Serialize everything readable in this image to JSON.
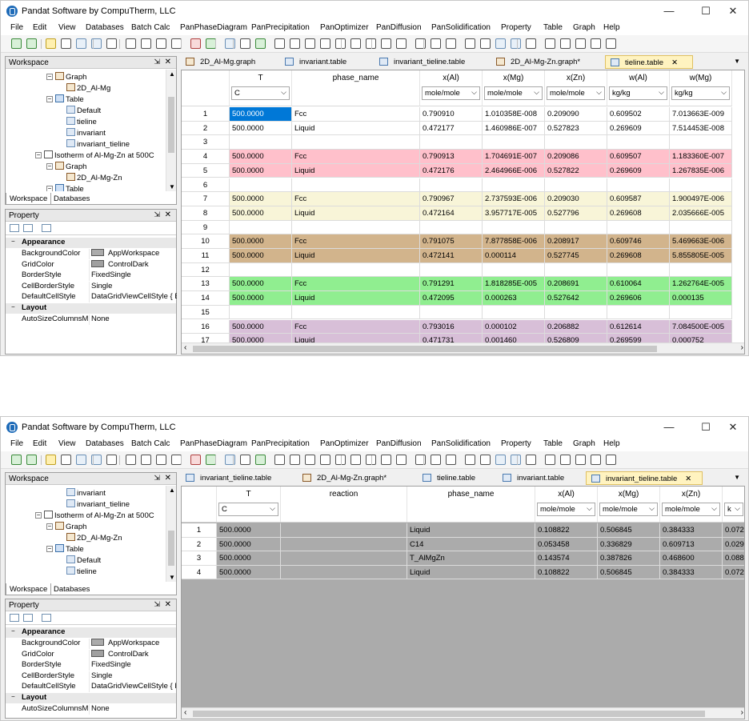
{
  "app_title": "Pandat Software by CompuTherm, LLC",
  "window_controls": [
    "—",
    "☐",
    "✕"
  ],
  "menu": [
    "File",
    "Edit",
    "View",
    "Databases",
    "Batch Calc",
    "PanPhaseDiagram",
    "PanPrecipitation",
    "PanOptimizer",
    "PanDiffusion",
    "PanSolidification",
    "Property",
    "Table",
    "Graph",
    "Help"
  ],
  "menu_underline": [
    "F",
    "E",
    "V",
    "D",
    "B",
    "P",
    "P",
    "P",
    "P",
    "P",
    "P",
    "T",
    "G",
    "H"
  ],
  "workspace": {
    "title": "Workspace",
    "pin": "⇲",
    "close": "✕",
    "tabs": [
      "Workspace",
      "Databases"
    ]
  },
  "property": {
    "title": "Property",
    "categories": [
      "Appearance",
      "Layout"
    ],
    "rows": [
      {
        "name": "BackgroundColor",
        "value": "AppWorkspace",
        "swatch": "#ababab"
      },
      {
        "name": "GridColor",
        "value": "ControlDark",
        "swatch": "#a0a0a0"
      },
      {
        "name": "BorderStyle",
        "value": "FixedSingle"
      },
      {
        "name": "CellBorderStyle",
        "value": "Single"
      },
      {
        "name": "DefaultCellStyle",
        "value": "DataGridViewCellStyle { B"
      }
    ],
    "layout_rows": [
      {
        "name": "AutoSizeColumnsM",
        "value": "None"
      }
    ]
  },
  "window1": {
    "tree": [
      {
        "label": "Graph",
        "icon": "graph",
        "indent": 1,
        "exp": "⊟"
      },
      {
        "label": "2D_Al-Mg",
        "icon": "graph",
        "indent": 2
      },
      {
        "label": "Table",
        "icon": "fold",
        "indent": 1,
        "exp": "⊟"
      },
      {
        "label": "Default",
        "icon": "table",
        "indent": 2
      },
      {
        "label": "tieline",
        "icon": "table",
        "indent": 2
      },
      {
        "label": "invariant",
        "icon": "table",
        "indent": 2
      },
      {
        "label": "invariant_tieline",
        "icon": "table",
        "indent": 2
      },
      {
        "label": "Isotherm of Al-Mg-Zn at 500C",
        "icon": "iso",
        "indent": 0,
        "exp": "⊟"
      },
      {
        "label": "Graph",
        "icon": "graph",
        "indent": 1,
        "exp": "⊟"
      },
      {
        "label": "2D_Al-Mg-Zn",
        "icon": "graph",
        "indent": 2
      },
      {
        "label": "Table",
        "icon": "fold",
        "indent": 1,
        "exp": "⊟"
      }
    ],
    "doc_tabs": [
      {
        "label": "2D_Al-Mg.graph",
        "type": "graph"
      },
      {
        "label": "invariant.table",
        "type": "table"
      },
      {
        "label": "invariant_tieline.table",
        "type": "table"
      },
      {
        "label": "2D_Al-Mg-Zn.graph*",
        "type": "graph"
      },
      {
        "label": "tieline.table",
        "type": "table",
        "active": true
      }
    ],
    "columns": [
      {
        "name": "T",
        "unit": "C"
      },
      {
        "name": "phase_name",
        "unit": ""
      },
      {
        "name": "x(Al)",
        "unit": "mole/mole"
      },
      {
        "name": "x(Mg)",
        "unit": "mole/mole"
      },
      {
        "name": "x(Zn)",
        "unit": "mole/mole"
      },
      {
        "name": "w(Al)",
        "unit": "kg/kg"
      },
      {
        "name": "w(Mg)",
        "unit": "kg/kg"
      }
    ],
    "rows": [
      {
        "n": "1",
        "c": [
          "500.0000",
          "Fcc",
          "0.790910",
          "1.010358E-008",
          "0.209090",
          "0.609502",
          "7.013663E-009"
        ],
        "bg": "#ffffff",
        "sel": true
      },
      {
        "n": "2",
        "c": [
          "500.0000",
          "Liquid",
          "0.472177",
          "1.460986E-007",
          "0.527823",
          "0.269609",
          "7.514453E-008"
        ],
        "bg": "#ffffff"
      },
      {
        "n": "3",
        "c": [
          "",
          "",
          "",
          "",
          "",
          "",
          ""
        ],
        "bg": "#ffffff"
      },
      {
        "n": "4",
        "c": [
          "500.0000",
          "Fcc",
          "0.790913",
          "1.704691E-007",
          "0.209086",
          "0.609507",
          "1.183360E-007"
        ],
        "bg": "#ffc0cb"
      },
      {
        "n": "5",
        "c": [
          "500.0000",
          "Liquid",
          "0.472176",
          "2.464966E-006",
          "0.527822",
          "0.269609",
          "1.267835E-006"
        ],
        "bg": "#ffc0cb"
      },
      {
        "n": "6",
        "c": [
          "",
          "",
          "",
          "",
          "",
          "",
          ""
        ],
        "bg": "#ffffff"
      },
      {
        "n": "7",
        "c": [
          "500.0000",
          "Fcc",
          "0.790967",
          "2.737593E-006",
          "0.209030",
          "0.609587",
          "1.900497E-006"
        ],
        "bg": "#f8f5d8"
      },
      {
        "n": "8",
        "c": [
          "500.0000",
          "Liquid",
          "0.472164",
          "3.957717E-005",
          "0.527796",
          "0.269608",
          "2.035666E-005"
        ],
        "bg": "#f8f5d8"
      },
      {
        "n": "9",
        "c": [
          "",
          "",
          "",
          "",
          "",
          "",
          ""
        ],
        "bg": "#ffffff"
      },
      {
        "n": "10",
        "c": [
          "500.0000",
          "Fcc",
          "0.791075",
          "7.877858E-006",
          "0.208917",
          "0.609746",
          "5.469663E-006"
        ],
        "bg": "#d2b48c"
      },
      {
        "n": "11",
        "c": [
          "500.0000",
          "Liquid",
          "0.472141",
          "0.000114",
          "0.527745",
          "0.269608",
          "5.855805E-005"
        ],
        "bg": "#d2b48c"
      },
      {
        "n": "12",
        "c": [
          "",
          "",
          "",
          "",
          "",
          "",
          ""
        ],
        "bg": "#ffffff"
      },
      {
        "n": "13",
        "c": [
          "500.0000",
          "Fcc",
          "0.791291",
          "1.818285E-005",
          "0.208691",
          "0.610064",
          "1.262764E-005"
        ],
        "bg": "#90ee90"
      },
      {
        "n": "14",
        "c": [
          "500.0000",
          "Liquid",
          "0.472095",
          "0.000263",
          "0.527642",
          "0.269606",
          "0.000135"
        ],
        "bg": "#90ee90"
      },
      {
        "n": "15",
        "c": [
          "",
          "",
          "",
          "",
          "",
          "",
          ""
        ],
        "bg": "#ffffff"
      },
      {
        "n": "16",
        "c": [
          "500.0000",
          "Fcc",
          "0.793016",
          "0.000102",
          "0.206882",
          "0.612614",
          "7.084500E-005"
        ],
        "bg": "#d8bfd8"
      },
      {
        "n": "17",
        "c": [
          "500.0000",
          "Liquid",
          "0.471731",
          "0.001460",
          "0.526809",
          "0.269599",
          "0.000752"
        ],
        "bg": "#d8bfd8"
      }
    ]
  },
  "window2": {
    "tree": [
      {
        "label": "invariant",
        "icon": "table",
        "indent": 2
      },
      {
        "label": "invariant_tieline",
        "icon": "table",
        "indent": 2
      },
      {
        "label": "Isotherm of Al-Mg-Zn at 500C",
        "icon": "iso",
        "indent": 0,
        "exp": "⊟"
      },
      {
        "label": "Graph",
        "icon": "graph",
        "indent": 1,
        "exp": "⊟"
      },
      {
        "label": "2D_Al-Mg-Zn",
        "icon": "graph",
        "indent": 2
      },
      {
        "label": "Table",
        "icon": "fold",
        "indent": 1,
        "exp": "⊟"
      },
      {
        "label": "Default",
        "icon": "table",
        "indent": 2
      },
      {
        "label": "tieline",
        "icon": "table",
        "indent": 2
      }
    ],
    "doc_tabs": [
      {
        "label": "invariant_tieline.table",
        "type": "table"
      },
      {
        "label": "2D_Al-Mg-Zn.graph*",
        "type": "graph"
      },
      {
        "label": "tieline.table",
        "type": "table"
      },
      {
        "label": "invariant.table",
        "type": "table"
      },
      {
        "label": "invariant_tieline.table",
        "type": "table",
        "active": true
      }
    ],
    "columns": [
      {
        "name": "T",
        "unit": "C"
      },
      {
        "name": "reaction",
        "unit": ""
      },
      {
        "name": "phase_name",
        "unit": ""
      },
      {
        "name": "x(Al)",
        "unit": "mole/mole"
      },
      {
        "name": "x(Mg)",
        "unit": "mole/mole"
      },
      {
        "name": "x(Zn)",
        "unit": "mole/mole"
      },
      {
        "name": "",
        "unit": "k"
      }
    ],
    "rows": [
      {
        "n": "1",
        "c": [
          "500.0000",
          "",
          "Liquid",
          "0.108822",
          "0.506845",
          "0.384333",
          "0.072"
        ]
      },
      {
        "n": "2",
        "c": [
          "500.0000",
          "",
          "C14",
          "0.053458",
          "0.336829",
          "0.609713",
          "0.029"
        ]
      },
      {
        "n": "3",
        "c": [
          "500.0000",
          "",
          "T_AlMgZn",
          "0.143574",
          "0.387826",
          "0.468600",
          "0.088"
        ]
      },
      {
        "n": "4",
        "c": [
          "500.0000",
          "",
          "Liquid",
          "0.108822",
          "0.506845",
          "0.384333",
          "0.072"
        ]
      }
    ]
  }
}
